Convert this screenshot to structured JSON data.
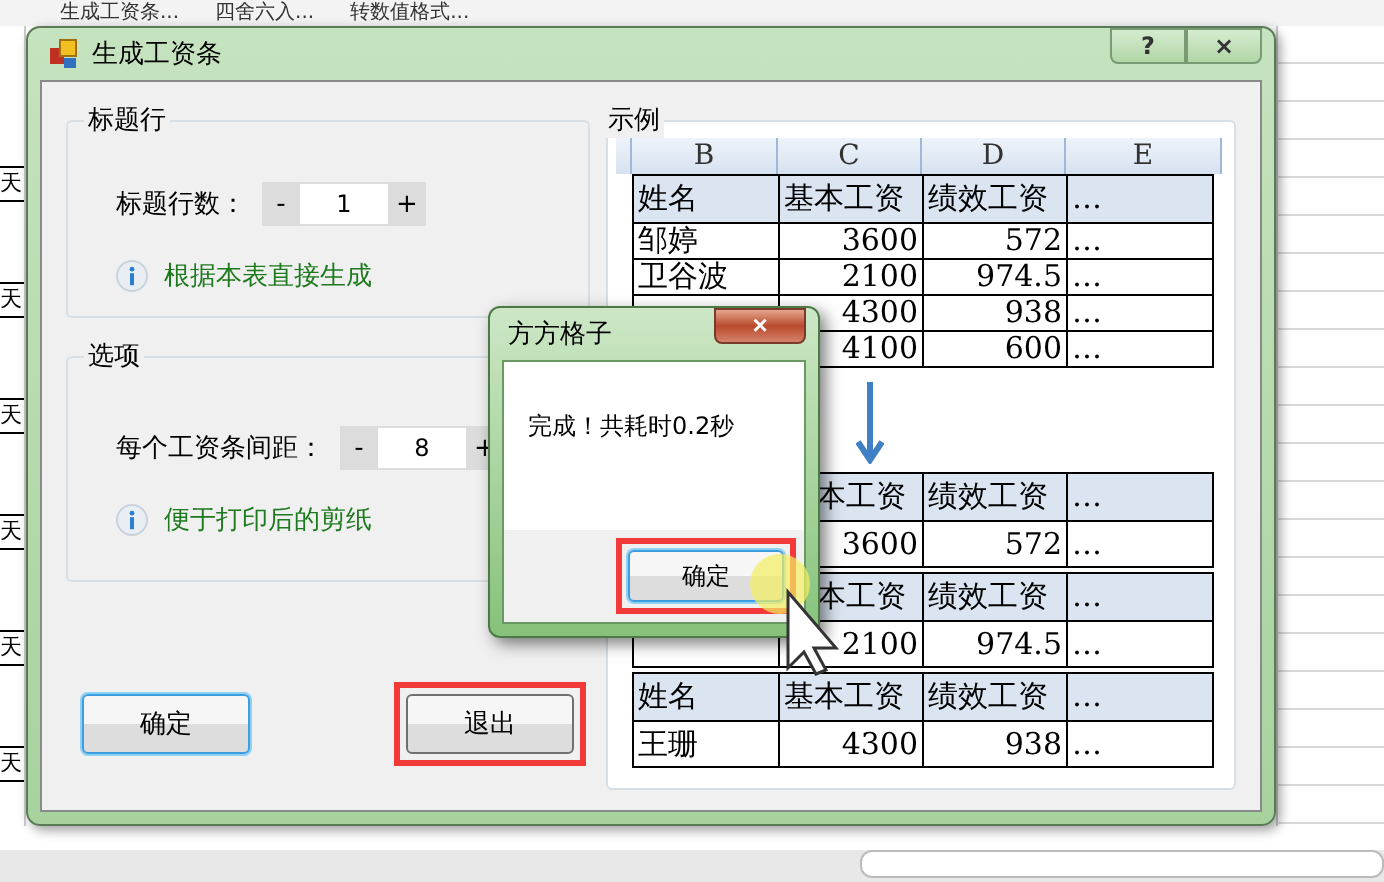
{
  "toolbar": [
    "生成工资条...",
    "四舍六入...",
    "转数值格式..."
  ],
  "sheet_cells": [
    "天",
    "天",
    "天",
    "天",
    "天",
    "天"
  ],
  "window": {
    "title": "生成工资条",
    "help": "?",
    "close": "×"
  },
  "groups": [
    {
      "title": "标题行",
      "label": "标题行数：",
      "minus": "-",
      "value": "1",
      "plus": "+",
      "hint": "根据本表直接生成"
    },
    {
      "title": "选项",
      "label": "每个工资条间距：",
      "minus": "-",
      "value": "8",
      "plus": "+",
      "hint": "便于打印后的剪纸"
    }
  ],
  "buttons": [
    {
      "label": "确定",
      "focused": true,
      "highlighted": false
    },
    {
      "label": "退出",
      "focused": false,
      "highlighted": true
    }
  ],
  "example": {
    "title": "示例",
    "columns": [
      "B",
      "C",
      "D",
      "E"
    ],
    "blocks": [
      {
        "rows": [
          {
            "kind": "header",
            "cells": [
              "姓名",
              "基本工资",
              "绩效工资",
              "…"
            ]
          },
          {
            "kind": "data",
            "cells": [
              "邹婷",
              "3600",
              "572",
              "…"
            ]
          },
          {
            "kind": "data",
            "cells": [
              "卫谷波",
              "2100",
              "974.5",
              "…"
            ]
          },
          {
            "kind": "data",
            "cells": [
              null,
              "4300",
              "938",
              "…"
            ]
          },
          {
            "kind": "data",
            "cells": [
              null,
              "4100",
              "600",
              "…"
            ]
          }
        ]
      },
      {
        "rows": [
          {
            "kind": "header",
            "cells": [
              null,
              "本工资",
              "绩效工资",
              "…"
            ]
          },
          {
            "kind": "data",
            "cells": [
              null,
              "3600",
              "572",
              "…"
            ]
          }
        ]
      },
      {
        "rows": [
          {
            "kind": "header",
            "cells": [
              null,
              "本工资",
              "绩效工资",
              "…"
            ]
          },
          {
            "kind": "data",
            "cells": [
              null,
              "2100",
              "974.5",
              "…"
            ]
          }
        ]
      },
      {
        "rows": [
          {
            "kind": "header",
            "cells": [
              "姓名",
              "基本工资",
              "绩效工资",
              "…"
            ]
          },
          {
            "kind": "data",
            "cells": [
              "王珊",
              "4300",
              "938",
              "…"
            ]
          }
        ]
      }
    ]
  },
  "message_box": {
    "title": "方方格子",
    "close": "×",
    "message": "完成！共耗时0.2秒",
    "button": {
      "label": "确定",
      "focused": true,
      "highlighted": true
    }
  }
}
